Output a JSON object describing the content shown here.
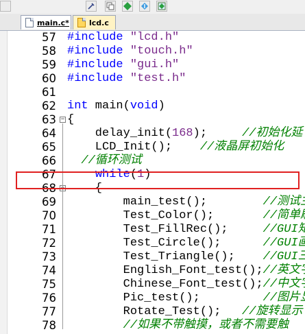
{
  "toolbar": {
    "icons": [
      "tools-icon",
      "copy-stack-icon",
      "diamond-icon",
      "download-diamond-icon",
      "grid-diamond-icon"
    ]
  },
  "tabs": [
    {
      "label": "main.c*",
      "active": true
    },
    {
      "label": "lcd.c",
      "active": false
    }
  ],
  "editor": {
    "lines": [
      {
        "num": "57",
        "tokens": [
          {
            "t": "#include ",
            "c": "pp"
          },
          {
            "t": "\"lcd.h\"",
            "c": "str"
          }
        ]
      },
      {
        "num": "58",
        "tokens": [
          {
            "t": "#include ",
            "c": "pp"
          },
          {
            "t": "\"touch.h\"",
            "c": "str"
          }
        ]
      },
      {
        "num": "59",
        "tokens": [
          {
            "t": "#include ",
            "c": "pp"
          },
          {
            "t": "\"gui.h\"",
            "c": "str"
          }
        ]
      },
      {
        "num": "60",
        "tokens": [
          {
            "t": "#include ",
            "c": "pp"
          },
          {
            "t": "\"test.h\"",
            "c": "str"
          }
        ]
      },
      {
        "num": "61",
        "tokens": []
      },
      {
        "num": "62",
        "tokens": [
          {
            "t": "int",
            "c": "kw"
          },
          {
            "t": " main(",
            "c": ""
          },
          {
            "t": "void",
            "c": "kw"
          },
          {
            "t": ")",
            "c": ""
          }
        ]
      },
      {
        "num": "63",
        "fold": "minus",
        "tokens": [
          {
            "t": "{",
            "c": ""
          }
        ]
      },
      {
        "num": "64",
        "tokens": [
          {
            "t": "    delay_init(",
            "c": ""
          },
          {
            "t": "168",
            "c": "num"
          },
          {
            "t": ");     ",
            "c": ""
          },
          {
            "t": "//初始化延",
            "c": "cmt"
          }
        ]
      },
      {
        "num": "65",
        "tokens": [
          {
            "t": "    LCD_Init();    ",
            "c": ""
          },
          {
            "t": "//液晶屏初始化",
            "c": "cmt"
          }
        ]
      },
      {
        "num": "66",
        "tokens": [
          {
            "t": "  ",
            "c": ""
          },
          {
            "t": "//循环测试",
            "c": "cmt"
          }
        ]
      },
      {
        "num": "67",
        "tokens": [
          {
            "t": "    ",
            "c": ""
          },
          {
            "t": "while",
            "c": "kw"
          },
          {
            "t": "(",
            "c": ""
          },
          {
            "t": "1",
            "c": "num"
          },
          {
            "t": ")",
            "c": ""
          }
        ]
      },
      {
        "num": "68",
        "fold": "minus",
        "tokens": [
          {
            "t": "    {",
            "c": ""
          }
        ]
      },
      {
        "num": "69",
        "tokens": [
          {
            "t": "        main_test();        ",
            "c": ""
          },
          {
            "t": "//测试主",
            "c": "cmt"
          }
        ]
      },
      {
        "num": "70",
        "tokens": [
          {
            "t": "        Test_Color();       ",
            "c": ""
          },
          {
            "t": "//简单刷",
            "c": "cmt"
          }
        ]
      },
      {
        "num": "71",
        "tokens": [
          {
            "t": "        Test_FillRec();     ",
            "c": ""
          },
          {
            "t": "//GUI矩",
            "c": "cmt"
          }
        ]
      },
      {
        "num": "72",
        "tokens": [
          {
            "t": "        Test_Circle();      ",
            "c": ""
          },
          {
            "t": "//GUI画",
            "c": "cmt"
          }
        ]
      },
      {
        "num": "73",
        "tokens": [
          {
            "t": "        Test_Triangle();    ",
            "c": ""
          },
          {
            "t": "//GUI三",
            "c": "cmt"
          }
        ]
      },
      {
        "num": "74",
        "tokens": [
          {
            "t": "        English_Font_test();",
            "c": ""
          },
          {
            "t": "//英文字",
            "c": "cmt"
          }
        ]
      },
      {
        "num": "75",
        "tokens": [
          {
            "t": "        Chinese_Font_test();",
            "c": ""
          },
          {
            "t": "//中文字",
            "c": "cmt"
          }
        ]
      },
      {
        "num": "76",
        "tokens": [
          {
            "t": "        Pic_test();         ",
            "c": ""
          },
          {
            "t": "//图片显",
            "c": "cmt"
          }
        ]
      },
      {
        "num": "77",
        "tokens": [
          {
            "t": "        Rotate_Test();   ",
            "c": ""
          },
          {
            "t": "//旋转显示",
            "c": "cmt"
          }
        ]
      },
      {
        "num": "78",
        "tokens": [
          {
            "t": "        ",
            "c": ""
          },
          {
            "t": "//如果不带触摸，或者不需要触",
            "c": "cmt"
          }
        ]
      }
    ]
  },
  "colors": {
    "keyword": "#0000ff",
    "string": "#7a2a8b",
    "comment": "#008000",
    "highlight": "#e02020"
  }
}
